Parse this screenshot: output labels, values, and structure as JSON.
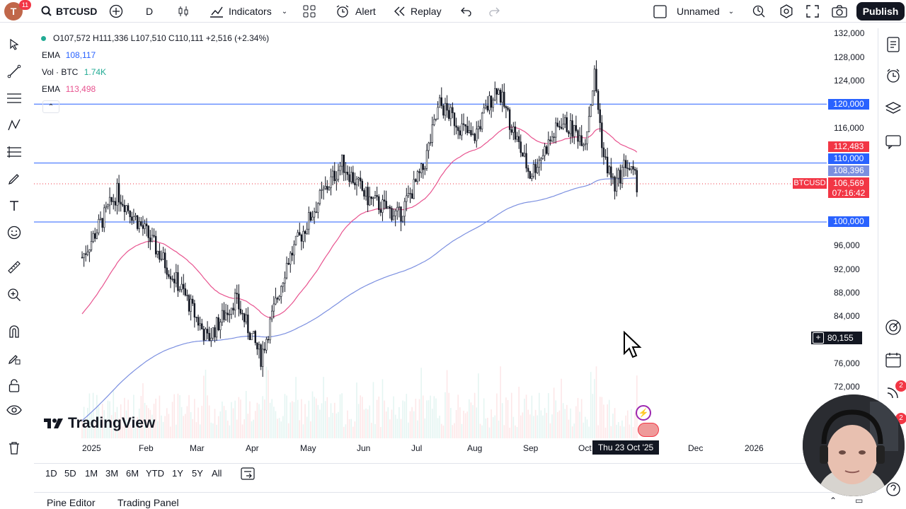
{
  "header": {
    "avatar_letter": "T",
    "notifications": "11",
    "symbol": "BTCUSD",
    "interval": "D",
    "indicators_label": "Indicators",
    "alert_label": "Alert",
    "replay_label": "Replay",
    "layout_name": "Unnamed",
    "publish_label": "Publish"
  },
  "legend": {
    "ohlc": "O107,572  H111,336  L107,510  C110,111  +2,516 (+2.34%)",
    "ema1_label": "EMA",
    "ema1_value": "108,117",
    "vol_label": "Vol · BTC",
    "vol_value": "1.74K",
    "ema2_label": "EMA",
    "ema2_value": "113,498"
  },
  "price_axis": {
    "ticks": [
      "132,000",
      "128,000",
      "124,000",
      "116,000",
      "96,000",
      "92,000",
      "88,000",
      "84,000",
      "76,000",
      "72,000"
    ],
    "lines": [
      {
        "label": "120,000",
        "price": 120000
      },
      {
        "label": "110,000",
        "price": 110000
      },
      {
        "label": "100,000",
        "price": 100000
      }
    ],
    "ema_red_label": "112,483",
    "ema_blue_label": "108,396",
    "last_price_label": "106,569",
    "countdown": "07:16:42",
    "symbol_tag": "BTCUSD",
    "cursor_price": "80,155"
  },
  "time_axis": {
    "labels": [
      "2025",
      "Feb",
      "Mar",
      "Apr",
      "May",
      "Jun",
      "Jul",
      "Aug",
      "Sep",
      "Oct",
      "Dec",
      "2026"
    ],
    "crosshair_date": "Thu 23 Oct '25"
  },
  "watermark": "TradingView",
  "ranges": [
    "1D",
    "5D",
    "1M",
    "3M",
    "6M",
    "YTD",
    "1Y",
    "5Y",
    "All"
  ],
  "panels": {
    "pine_editor": "Pine Editor",
    "trading_panel": "Trading Panel"
  },
  "right_badges": {
    "badge1": "2",
    "badge2": "2"
  },
  "colors": {
    "blue_line": "#2962ff",
    "ema_red": "#e8538f",
    "ema_blue": "#7b8fe0",
    "up": "#131722",
    "last_price": "#f23645"
  },
  "chart_data": {
    "type": "candlestick",
    "symbol": "BTCUSD",
    "interval": "D",
    "x_range": [
      "2025-01",
      "2026-01"
    ],
    "ylim": [
      70000,
      133000
    ],
    "approx_daily_close": [
      {
        "date": "2025-01-01",
        "price": 94000
      },
      {
        "date": "2025-01-20",
        "price": 105000
      },
      {
        "date": "2025-02-05",
        "price": 98000
      },
      {
        "date": "2025-02-25",
        "price": 88000
      },
      {
        "date": "2025-03-10",
        "price": 80000
      },
      {
        "date": "2025-03-25",
        "price": 87000
      },
      {
        "date": "2025-04-08",
        "price": 77000
      },
      {
        "date": "2025-04-22",
        "price": 93000
      },
      {
        "date": "2025-05-10",
        "price": 104000
      },
      {
        "date": "2025-05-22",
        "price": 110000
      },
      {
        "date": "2025-06-05",
        "price": 104000
      },
      {
        "date": "2025-06-22",
        "price": 101000
      },
      {
        "date": "2025-07-05",
        "price": 109000
      },
      {
        "date": "2025-07-14",
        "price": 120000
      },
      {
        "date": "2025-08-01",
        "price": 114000
      },
      {
        "date": "2025-08-14",
        "price": 123000
      },
      {
        "date": "2025-09-01",
        "price": 108000
      },
      {
        "date": "2025-09-18",
        "price": 117000
      },
      {
        "date": "2025-10-01",
        "price": 114000
      },
      {
        "date": "2025-10-06",
        "price": 125000
      },
      {
        "date": "2025-10-11",
        "price": 111000
      },
      {
        "date": "2025-10-17",
        "price": 106000
      },
      {
        "date": "2025-10-23",
        "price": 110111
      },
      {
        "date": "2025-10-29",
        "price": 106569
      }
    ]
  }
}
